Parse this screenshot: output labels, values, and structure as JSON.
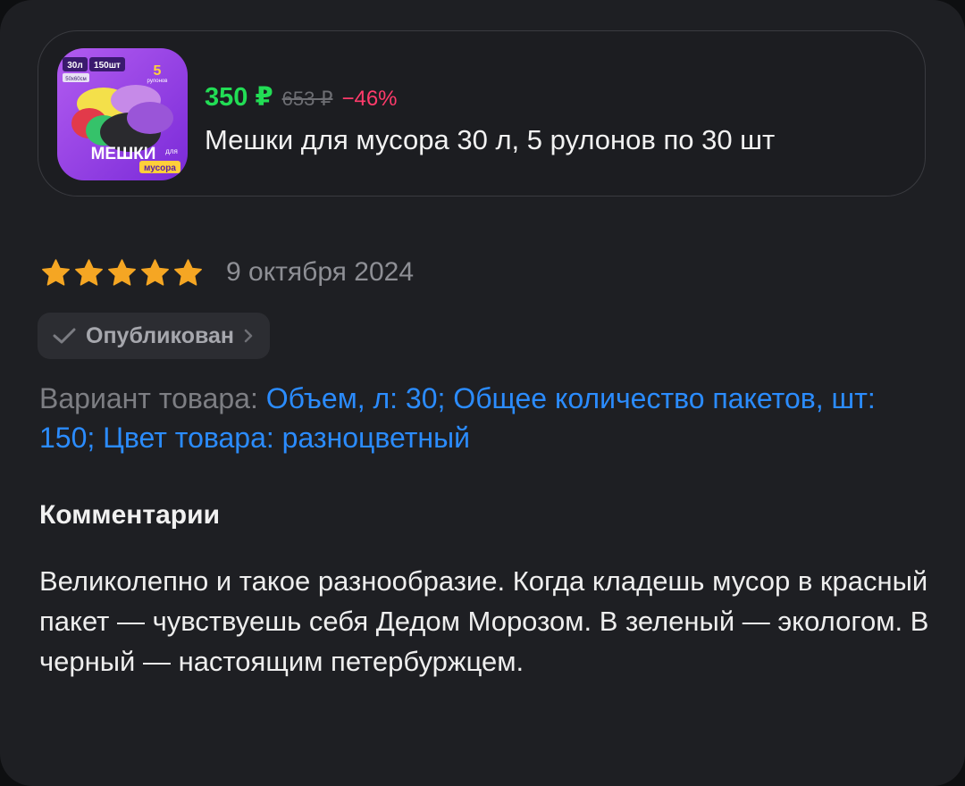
{
  "product": {
    "image_alt": "Мешки для мусора",
    "image_text": {
      "volume": "30л",
      "count": "150шт",
      "size": "50x60см",
      "rolls_num": "5",
      "rolls_word": "рулонов",
      "brand_line1": "МЕШКИ",
      "brand_line2": "для",
      "brand_line3": "мусора"
    },
    "price": "350 ₽",
    "old_price": "653 ₽",
    "discount": "−46%",
    "title": "Мешки для мусора 30 л, 5 рулонов по 30 шт"
  },
  "review": {
    "rating": 5,
    "max_rating": 5,
    "date": "9 октября 2024",
    "status": "Опубликован",
    "variant_label": "Вариант товара:",
    "variant_value": "Объем, л: 30; Общее количество пакетов, шт: 150; Цвет товара: разноцветный",
    "comments_title": "Комментарии",
    "comment": "Великолепно и такое разнообразие. Когда кладешь мусор в красный пакет — чувствуешь себя Дедом Морозом. В зеленый — экологом. В черный — настоящим петербуржцем."
  },
  "colors": {
    "background": "#1e1f23",
    "price": "#22dd55",
    "discount": "#ff3b6b",
    "link": "#2b8cff",
    "star": "#f5a623",
    "muted": "#8e8f95"
  }
}
